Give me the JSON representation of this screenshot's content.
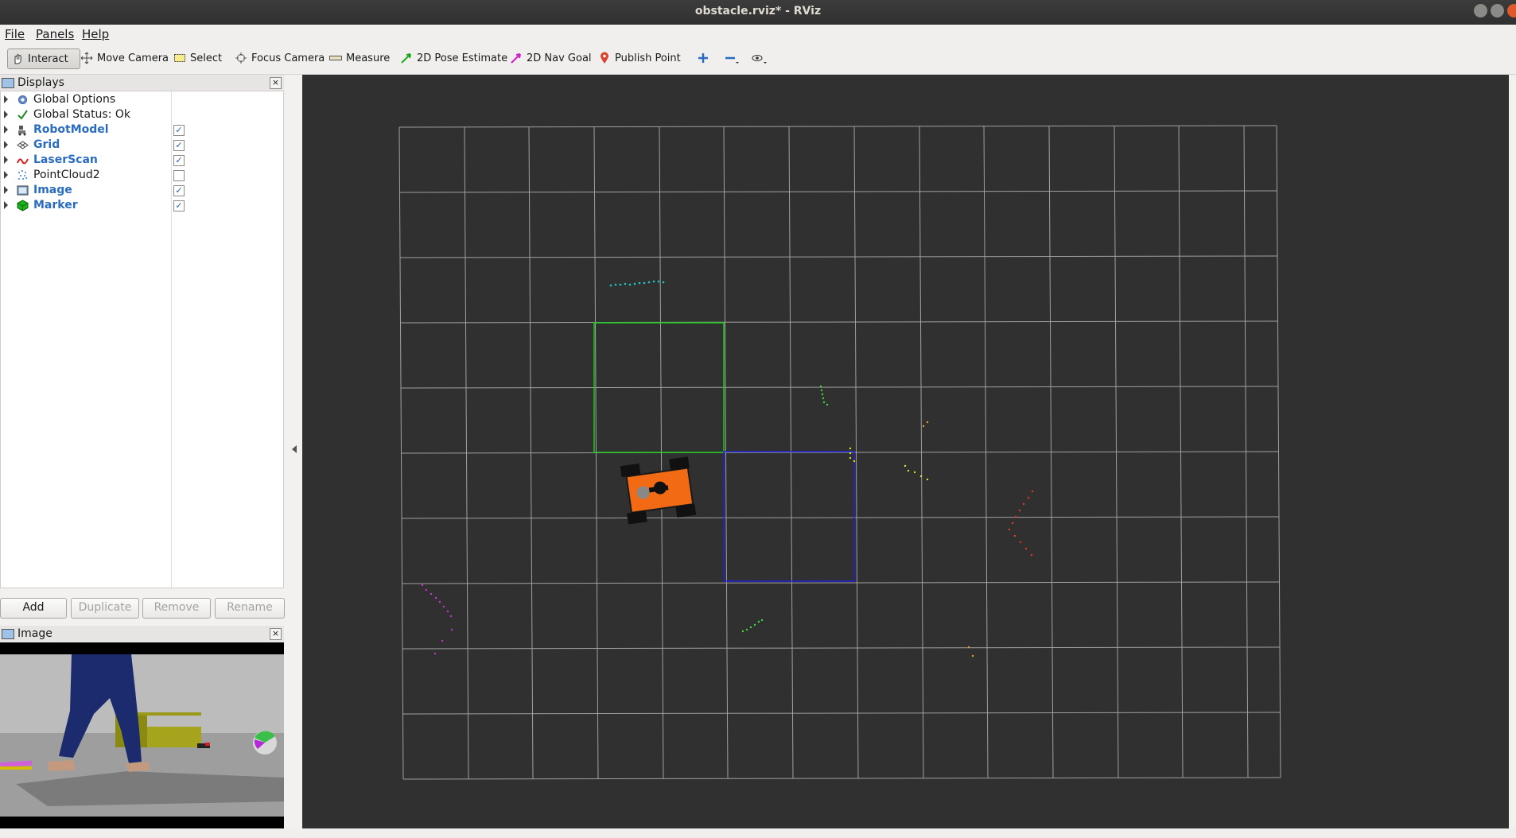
{
  "window": {
    "title": "obstacle.rviz* - RViz"
  },
  "menu": {
    "file": "File",
    "panels": "Panels",
    "help": "Help"
  },
  "toolbar": {
    "interact": "Interact",
    "move_camera": "Move Camera",
    "select": "Select",
    "focus_camera": "Focus Camera",
    "measure": "Measure",
    "pose_estimate": "2D Pose Estimate",
    "nav_goal": "2D Nav Goal",
    "publish_point": "Publish Point"
  },
  "displays": {
    "title": "Displays",
    "items": [
      {
        "label": "Global Options",
        "icon": "gear-icon",
        "checked": null
      },
      {
        "label": "Global Status: Ok",
        "icon": "checkmark-icon",
        "checked": null
      },
      {
        "label": "RobotModel",
        "icon": "robot-model-icon",
        "checked": true
      },
      {
        "label": "Grid",
        "icon": "grid-icon",
        "checked": true
      },
      {
        "label": "LaserScan",
        "icon": "laser-scan-icon",
        "checked": true
      },
      {
        "label": "PointCloud2",
        "icon": "point-cloud-icon",
        "checked": false
      },
      {
        "label": "Image",
        "icon": "image-icon",
        "checked": true
      },
      {
        "label": "Marker",
        "icon": "marker-icon",
        "checked": true
      }
    ],
    "buttons": {
      "add": "Add",
      "duplicate": "Duplicate",
      "remove": "Remove",
      "rename": "Rename"
    }
  },
  "image_panel": {
    "title": "Image"
  },
  "colors": {
    "accent_blue": "#2a6cc1",
    "goal_square": "#1ecb1e",
    "marker_square": "#2020d8",
    "robot": "#f26a14",
    "viewport": "#303030"
  }
}
